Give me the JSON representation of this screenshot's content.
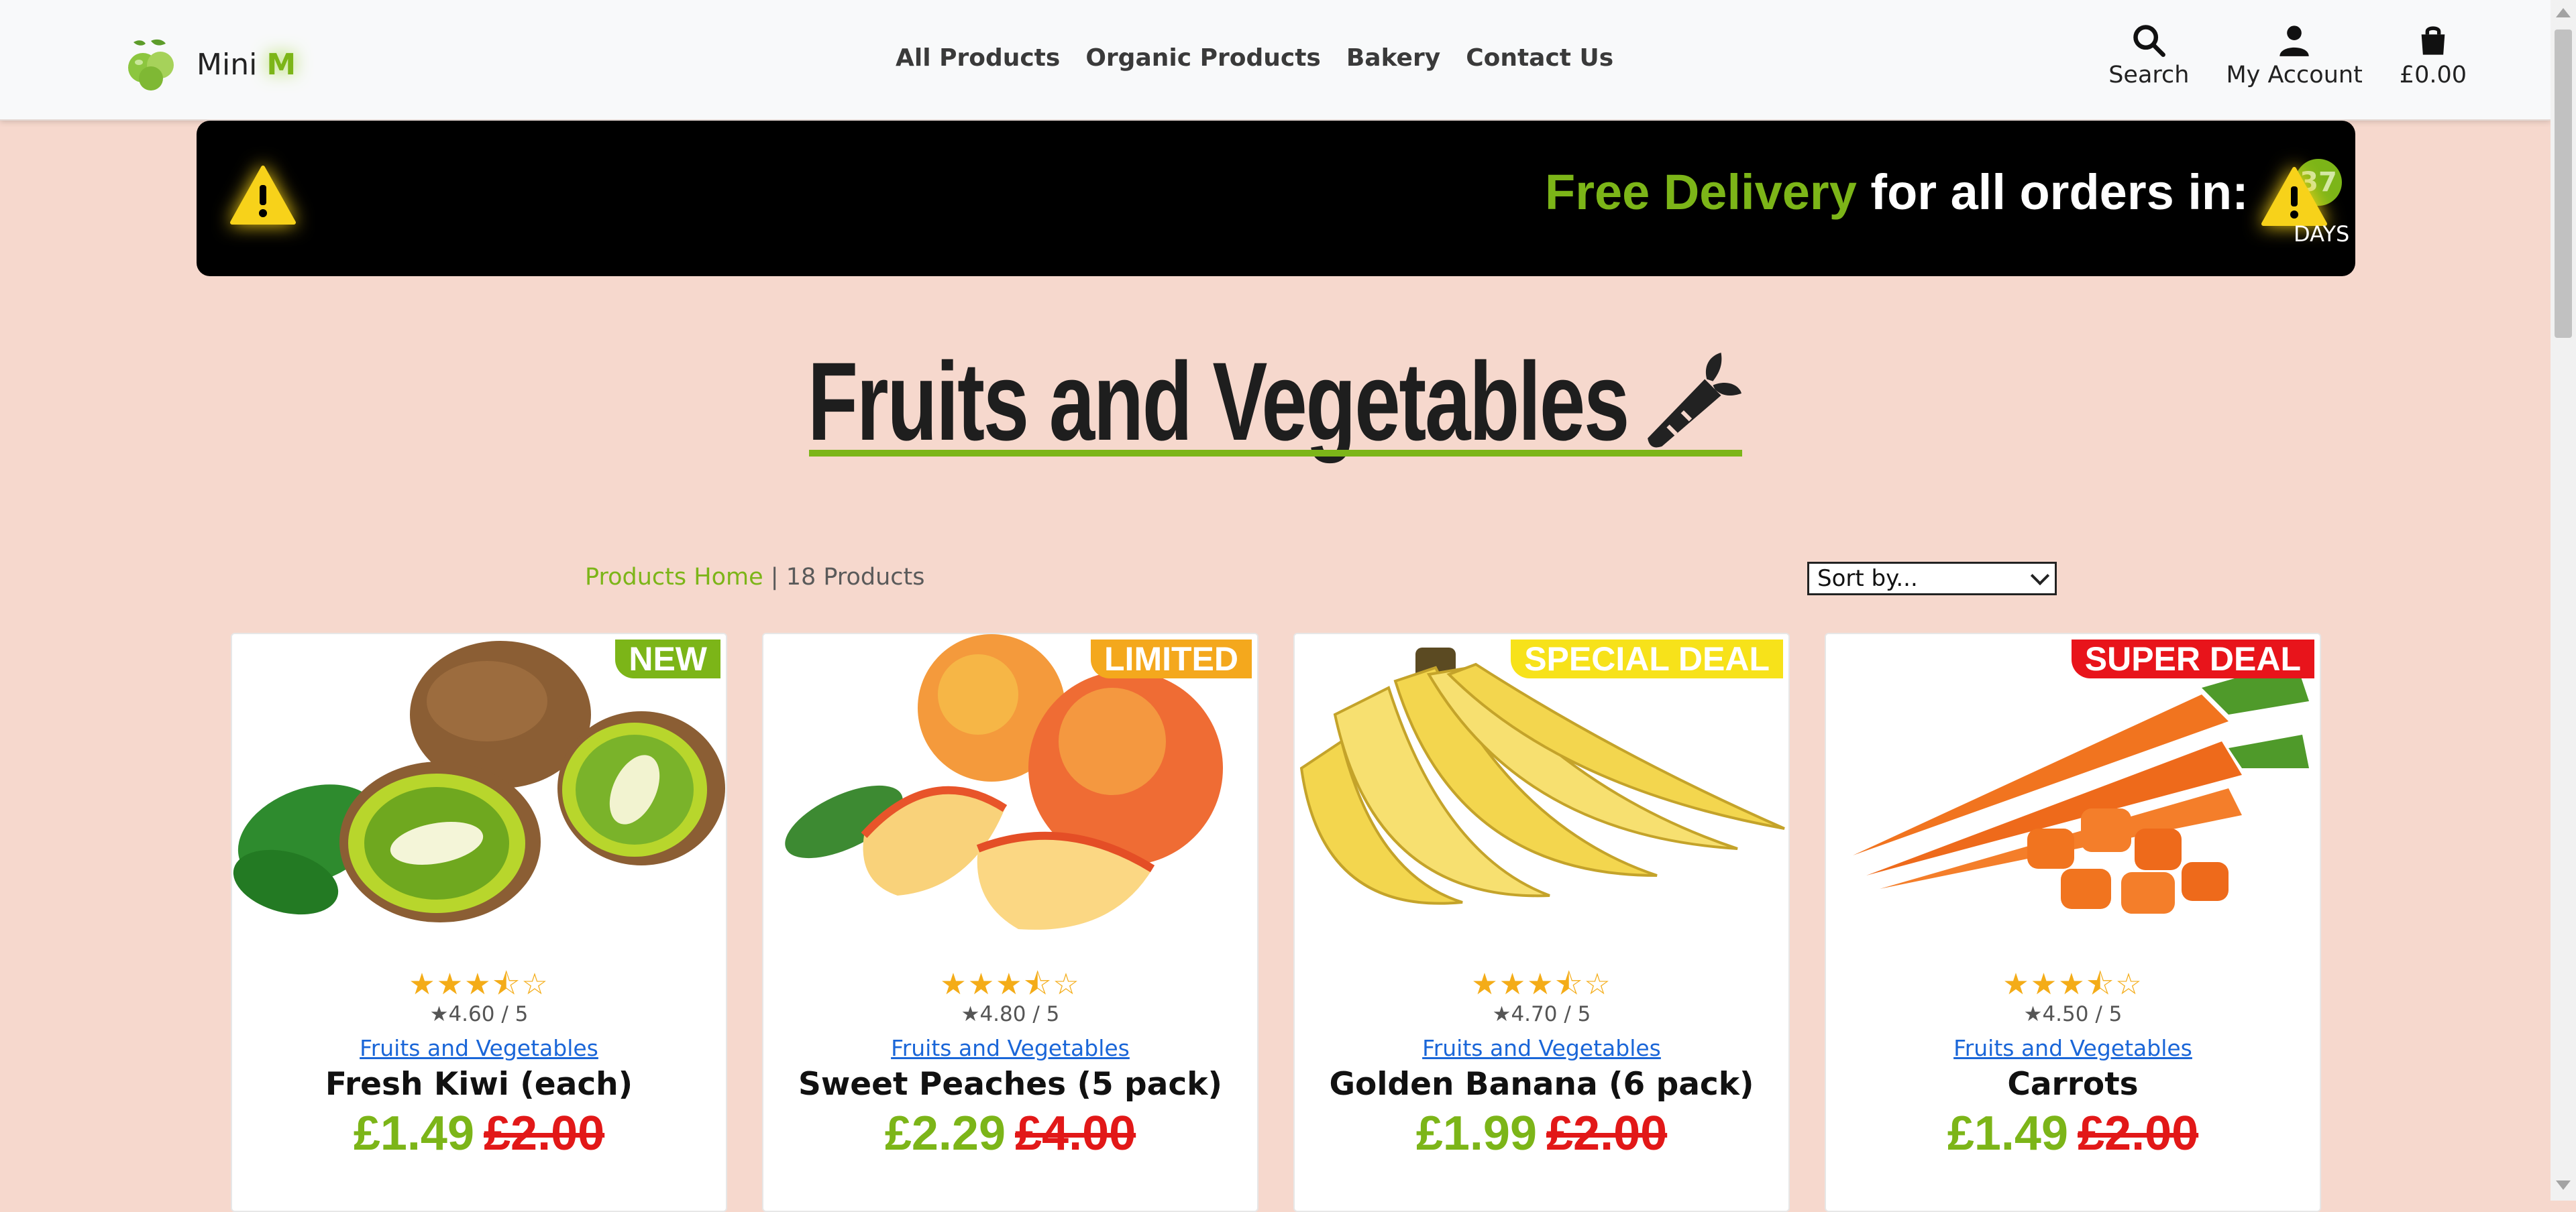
{
  "brand": {
    "name": "Mini",
    "accent_letter": "M",
    "accent_color": "#7cb518"
  },
  "nav": {
    "links": [
      "All Products",
      "Organic Products",
      "Bakery",
      "Contact Us"
    ],
    "search_label": "Search",
    "account_label": "My Account",
    "cart_total": "£0.00"
  },
  "banner": {
    "highlight": "Free Delivery",
    "text": "for all orders in:",
    "countdown_value": "37",
    "countdown_unit": "DAYS"
  },
  "page": {
    "title": "Fruits and Vegetables",
    "title_icon": "carrot-icon",
    "breadcrumb_link": "Products Home",
    "breadcrumb_separator": "|",
    "product_count": "18 Products",
    "sort_label": "Sort by..."
  },
  "products": [
    {
      "badge": "NEW",
      "badge_color": "#7cb518",
      "stars": "★★★⯪☆",
      "rating": "4.60 / 5",
      "category": "Fruits and Vegetables",
      "name": "Fresh Kiwi (each)",
      "price": "£1.49",
      "old_price": "£2.00"
    },
    {
      "badge": "LIMITED",
      "badge_color": "#f4a81d",
      "stars": "★★★⯪☆",
      "rating": "4.80 / 5",
      "category": "Fruits and Vegetables",
      "name": "Sweet Peaches (5 pack)",
      "price": "£2.29",
      "old_price": "£4.00"
    },
    {
      "badge": "SPECIAL DEAL",
      "badge_color": "#f7e21a",
      "stars": "★★★⯪☆",
      "rating": "4.70 / 5",
      "category": "Fruits and Vegetables",
      "name": "Golden Banana (6 pack)",
      "price": "£1.99",
      "old_price": "£2.00"
    },
    {
      "badge": "SUPER DEAL",
      "badge_color": "#e8141b",
      "stars": "★★★⯪☆",
      "rating": "4.50 / 5",
      "category": "Fruits and Vegetables",
      "name": "Carrots",
      "price": "£1.49",
      "old_price": "£2.00"
    }
  ],
  "colors": {
    "background": "#f6d8cd",
    "price_green": "#7cb518",
    "price_red": "#e21818",
    "star": "#f4ac18"
  }
}
